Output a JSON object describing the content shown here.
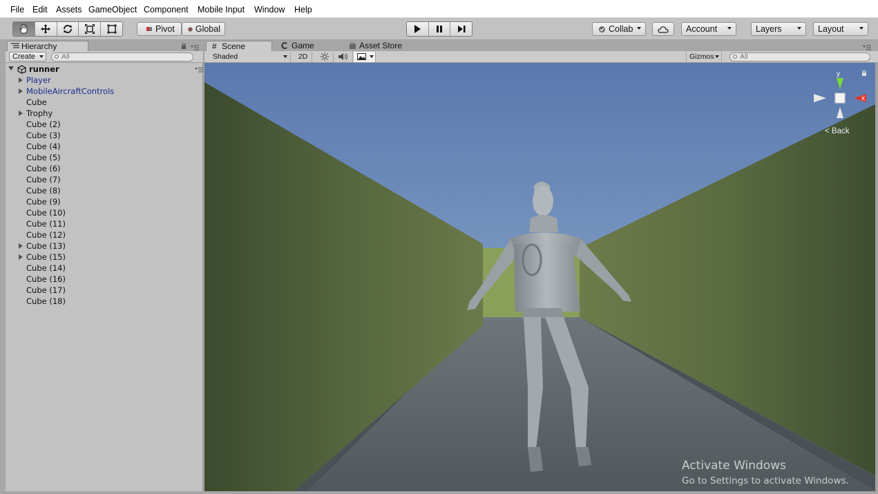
{
  "menu": [
    "File",
    "Edit",
    "Assets",
    "GameObject",
    "Component",
    "Mobile Input",
    "Window",
    "Help"
  ],
  "toolbar": {
    "pivot": "Pivot",
    "global": "Global",
    "collab": "Collab",
    "account": "Account",
    "layers": "Layers",
    "layout": "Layout"
  },
  "hierarchy": {
    "tab": "Hierarchy",
    "create": "Create",
    "search_placeholder": "All",
    "scene_name": "runner",
    "items": [
      {
        "label": "Player",
        "prefab": true,
        "expandable": true
      },
      {
        "label": "MobileAircraftControls",
        "prefab": true,
        "expandable": true
      },
      {
        "label": "Cube",
        "prefab": false,
        "expandable": false
      },
      {
        "label": "Trophy",
        "prefab": false,
        "expandable": true
      },
      {
        "label": "Cube (2)",
        "prefab": false,
        "expandable": false
      },
      {
        "label": "Cube (3)",
        "prefab": false,
        "expandable": false
      },
      {
        "label": "Cube (4)",
        "prefab": false,
        "expandable": false
      },
      {
        "label": "Cube (5)",
        "prefab": false,
        "expandable": false
      },
      {
        "label": "Cube (6)",
        "prefab": false,
        "expandable": false
      },
      {
        "label": "Cube (7)",
        "prefab": false,
        "expandable": false
      },
      {
        "label": "Cube (8)",
        "prefab": false,
        "expandable": false
      },
      {
        "label": "Cube (9)",
        "prefab": false,
        "expandable": false
      },
      {
        "label": "Cube (10)",
        "prefab": false,
        "expandable": false
      },
      {
        "label": "Cube (11)",
        "prefab": false,
        "expandable": false
      },
      {
        "label": "Cube (12)",
        "prefab": false,
        "expandable": false
      },
      {
        "label": "Cube (13)",
        "prefab": false,
        "expandable": true
      },
      {
        "label": "Cube (15)",
        "prefab": false,
        "expandable": true
      },
      {
        "label": "Cube (14)",
        "prefab": false,
        "expandable": false
      },
      {
        "label": "Cube (16)",
        "prefab": false,
        "expandable": false
      },
      {
        "label": "Cube (17)",
        "prefab": false,
        "expandable": false
      },
      {
        "label": "Cube (18)",
        "prefab": false,
        "expandable": false
      }
    ]
  },
  "scene": {
    "tabs": [
      "Scene",
      "Game",
      "Asset Store"
    ],
    "shading": "Shaded",
    "mode_2d": "2D",
    "gizmos": "Gizmos",
    "search_placeholder": "All",
    "gizmo_x": "x",
    "gizmo_y": "y",
    "gizmo_back": "Back"
  },
  "watermark": {
    "line1": "Activate Windows",
    "line2": "Go to Settings to activate Windows."
  },
  "colors": {
    "sky": "#5a7ab0",
    "wall": "#4e5f38",
    "floor": "#5d6468",
    "prefab_text": "#1a2c8c"
  }
}
